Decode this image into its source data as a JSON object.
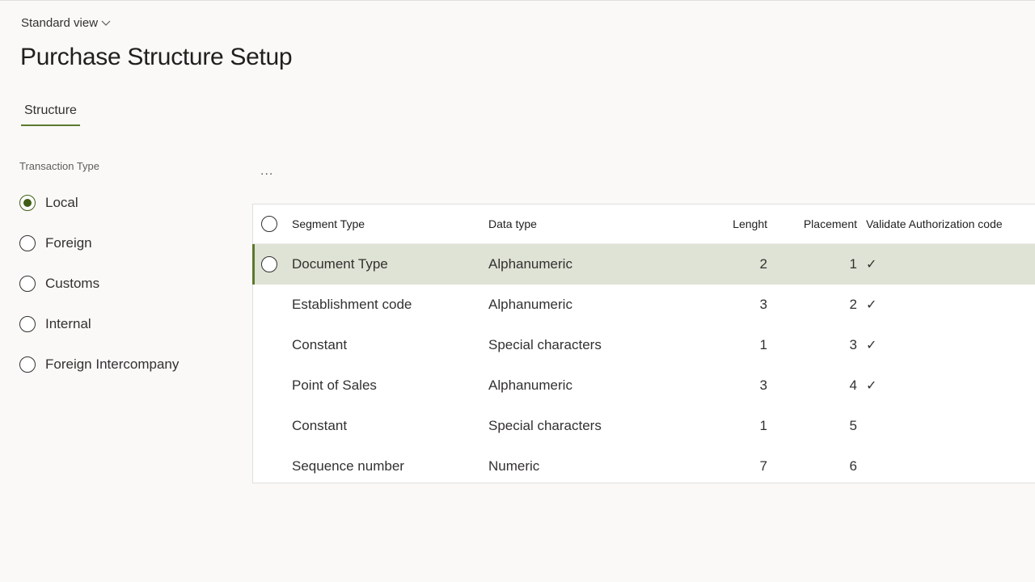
{
  "header": {
    "view_label": "Standard view",
    "view_chevron": "chevron-down-icon",
    "title": "Purchase Structure Setup"
  },
  "tabs": [
    {
      "label": "Structure",
      "active": true
    }
  ],
  "transaction_type": {
    "label": "Transaction Type",
    "selected": "Local",
    "options": [
      "Local",
      "Foreign",
      "Customs",
      "Internal",
      "Foreign Intercompany"
    ]
  },
  "grid": {
    "more_label": "...",
    "columns": {
      "segment_type": "Segment Type",
      "data_type": "Data type",
      "length": "Lenght",
      "placement": "Placement",
      "validate": "Validate Authorization code"
    },
    "rows": [
      {
        "segment_type": "Document Type",
        "data_type": "Alphanumeric",
        "length": "2",
        "placement": "1",
        "validate": "✓"
      },
      {
        "segment_type": "Establishment code",
        "data_type": "Alphanumeric",
        "length": "3",
        "placement": "2",
        "validate": "✓"
      },
      {
        "segment_type": "Constant",
        "data_type": "Special characters",
        "length": "1",
        "placement": "3",
        "validate": "✓"
      },
      {
        "segment_type": "Point of Sales",
        "data_type": "Alphanumeric",
        "length": "3",
        "placement": "4",
        "validate": "✓"
      },
      {
        "segment_type": "Constant",
        "data_type": "Special characters",
        "length": "1",
        "placement": "5",
        "validate": ""
      },
      {
        "segment_type": "Sequence number",
        "data_type": "Numeric",
        "length": "7",
        "placement": "6",
        "validate": ""
      }
    ],
    "selected_row": 0
  },
  "colors": {
    "accent": "#5b7a2e",
    "selected_row_bg": "#dfe3d5",
    "page_bg": "#faf9f8"
  }
}
